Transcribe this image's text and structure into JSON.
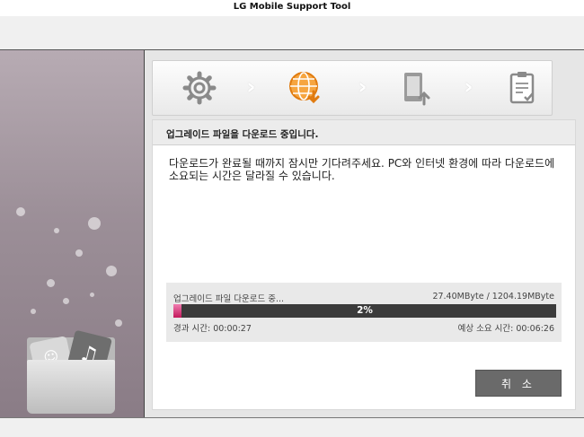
{
  "window": {
    "title": "LG Mobile Support Tool"
  },
  "steps": [
    {
      "name": "settings",
      "icon": "gear-icon",
      "active": false
    },
    {
      "name": "download",
      "icon": "globe-download-icon",
      "active": true
    },
    {
      "name": "upgrade",
      "icon": "phone-upload-icon",
      "active": false
    },
    {
      "name": "complete",
      "icon": "clipboard-check-icon",
      "active": false
    }
  ],
  "panel": {
    "header": "업그레이드 파일을 다운로드 중입니다.",
    "message": "다운로드가 완료될 때까지 잠시만 기다려주세요. PC와 인터넷 환경에 따라 다운로드에 소요되는 시간은 달라질 수 있습니다."
  },
  "progress": {
    "label": "업그레이드 파일 다운로드 중...",
    "size": "27.40MByte / 1204.19MByte",
    "percent": 2,
    "percent_text": "2%",
    "elapsed": "경과 시간: 00:00:27",
    "remaining": "예상 소요 시간: 00:06:26"
  },
  "buttons": {
    "cancel": "취 소"
  },
  "colors": {
    "accent": "#f08a1c",
    "progress_fill": "#d81b60",
    "button": "#6a6a6a"
  }
}
